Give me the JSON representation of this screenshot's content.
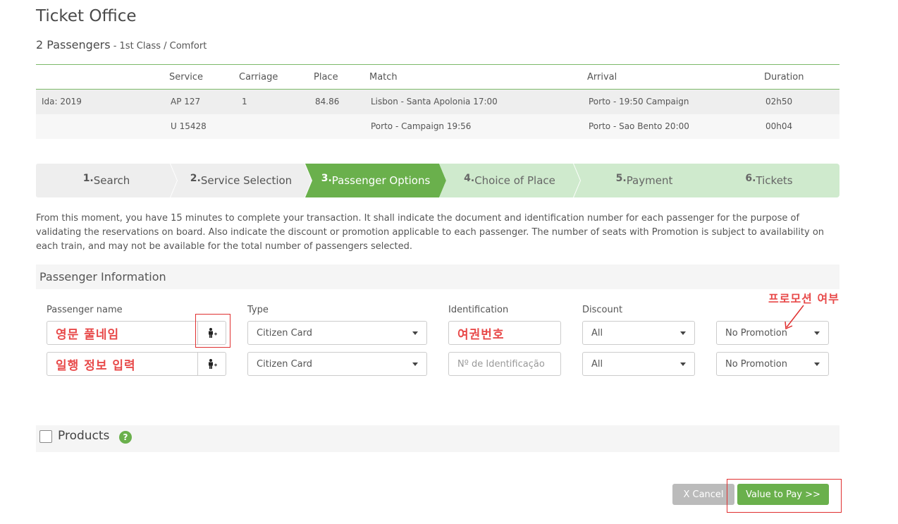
{
  "header": {
    "title": "Ticket Office",
    "passengers": "2 Passengers",
    "class_info": " - 1st Class / Comfort"
  },
  "trip_table": {
    "columns": [
      "",
      "Service",
      "Carriage",
      "Place",
      "Match",
      "Arrival",
      "Duration"
    ],
    "rows": [
      [
        "Ida: 2019",
        "AP 127",
        "1",
        "84.86",
        "Lisbon - Santa Apolonia 17:00",
        "Porto - 19:50 Campaign",
        "02h50"
      ],
      [
        "",
        "U 15428",
        "",
        "",
        "Porto - Campaign 19:56",
        "Porto - Sao Bento 20:00",
        "00h04"
      ]
    ]
  },
  "steps": [
    {
      "num": "1.",
      "label": "Search",
      "state": "done"
    },
    {
      "num": "2.",
      "label": "Service Selection",
      "state": "done"
    },
    {
      "num": "3.",
      "label": "Passenger Options",
      "state": "active"
    },
    {
      "num": "4.",
      "label": "Choice of Place",
      "state": "todo"
    },
    {
      "num": "5.",
      "label": "Payment",
      "state": "todo"
    },
    {
      "num": "6.",
      "label": "Tickets",
      "state": "todo"
    }
  ],
  "intro_text": "From this moment, you have 15 minutes to complete your transaction. It shall indicate the document and identification number for each passenger for the purpose of validating the reservations on board. Also indicate the discount or promotion applicable to each passenger. The number of seats with Promotion is subject to availability on each train, and may not be available for the total number of passengers selected.",
  "passenger_info": {
    "title": "Passenger Information",
    "labels": {
      "name": "Passenger name",
      "type": "Type",
      "identification": "Identification",
      "discount": "Discount"
    },
    "rows": [
      {
        "name": "영문 풀네임",
        "type": "Citizen Card",
        "identification": "여권번호",
        "id_placeholder": "",
        "discount": "All",
        "promotion": "No Promotion"
      },
      {
        "name": "일행 정보 입력",
        "type": "Citizen Card",
        "identification": "",
        "id_placeholder": "Nº de Identificação",
        "discount": "All",
        "promotion": "No Promotion"
      }
    ],
    "annotation": "프로모션 여부"
  },
  "products": {
    "label": "Products",
    "help": "?"
  },
  "buttons": {
    "cancel": "X Cancel",
    "pay": "Value to Pay >>"
  },
  "colors": {
    "accent_green": "#6ab04c",
    "light_green": "#cfeacd",
    "annotation_red": "#e84a4a"
  }
}
